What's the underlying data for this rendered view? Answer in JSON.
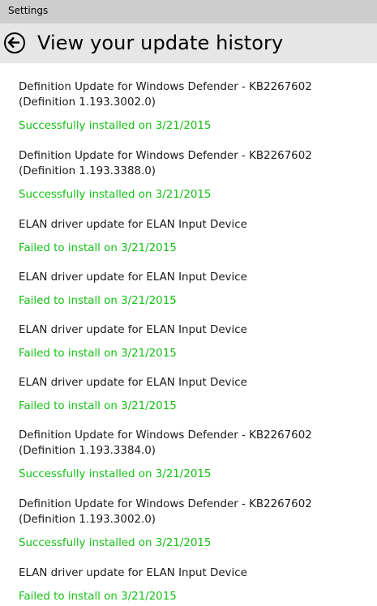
{
  "window": {
    "title": "Settings"
  },
  "header": {
    "title": "View your update history"
  },
  "updates": [
    {
      "name": "Definition Update for Windows Defender - KB2267602 (Definition 1.193.3002.0)",
      "status": "Successfully installed on 3/21/2015"
    },
    {
      "name": "Definition Update for Windows Defender - KB2267602 (Definition 1.193.3388.0)",
      "status": "Successfully installed on 3/21/2015"
    },
    {
      "name": "ELAN driver update for ELAN Input Device",
      "status": "Failed to install on 3/21/2015"
    },
    {
      "name": "ELAN driver update for ELAN Input Device",
      "status": "Failed to install on 3/21/2015"
    },
    {
      "name": "ELAN driver update for ELAN Input Device",
      "status": "Failed to install on 3/21/2015"
    },
    {
      "name": "ELAN driver update for ELAN Input Device",
      "status": "Failed to install on 3/21/2015"
    },
    {
      "name": "Definition Update for Windows Defender - KB2267602 (Definition 1.193.3384.0)",
      "status": "Successfully installed on 3/21/2015"
    },
    {
      "name": "Definition Update for Windows Defender - KB2267602 (Definition 1.193.3002.0)",
      "status": "Successfully installed on 3/21/2015"
    },
    {
      "name": "ELAN driver update for ELAN Input Device",
      "status": "Failed to install on 3/21/2015"
    }
  ],
  "colors": {
    "status_text": "#15c015",
    "titlebar": "#cdcdcd",
    "header": "#e6e6e6"
  },
  "icons": {
    "back": "back-arrow-icon"
  }
}
